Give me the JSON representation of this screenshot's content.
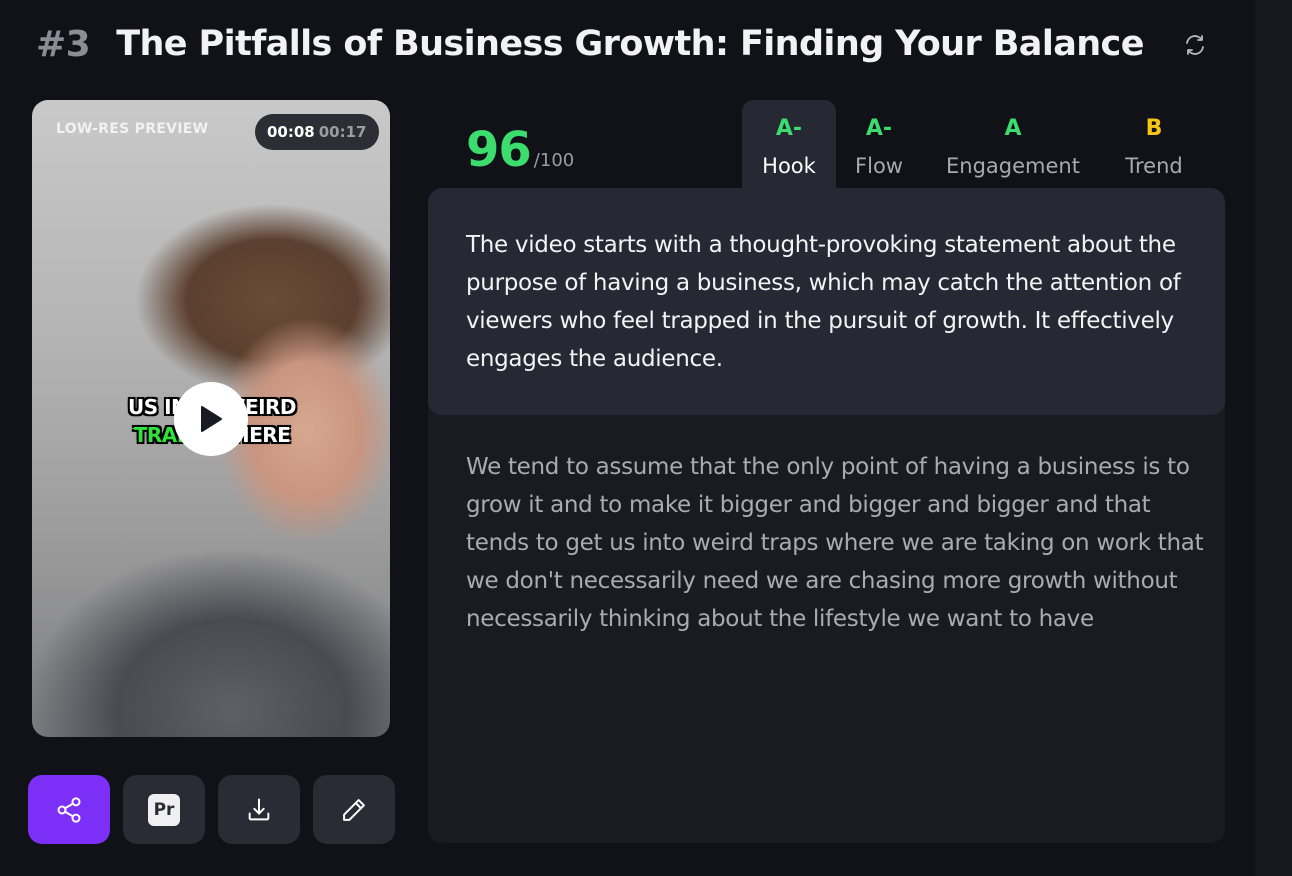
{
  "header": {
    "rank": "#3",
    "title": "The Pitfalls of Business Growth: Finding Your Balance",
    "refresh_icon": "refresh-icon"
  },
  "video": {
    "label": "LOW-RES PREVIEW",
    "time_current": "00:08",
    "time_total": "00:17",
    "caption_line1": "US INTO WEIRD",
    "caption_line2_green": "TRAPS",
    "caption_line2_white": "WHERE",
    "play_icon": "play-icon"
  },
  "actions": {
    "share_icon": "share-icon",
    "premiere_label": "Pr",
    "download_icon": "download-icon",
    "edit_icon": "pencil-icon"
  },
  "score": {
    "value": "96",
    "max": "/100"
  },
  "tabs": [
    {
      "grade": "A-",
      "label": "Hook",
      "active": true,
      "grade_color": "#3ddc6e"
    },
    {
      "grade": "A-",
      "label": "Flow",
      "active": false,
      "grade_color": "#3ddc6e"
    },
    {
      "grade": "A",
      "label": "Engagement",
      "active": false,
      "grade_color": "#3ddc6e"
    },
    {
      "grade": "B",
      "label": "Trend",
      "active": false,
      "grade_color": "#f5c518"
    }
  ],
  "summary": "The video starts with a thought-provoking statement about the purpose of having a business, which may catch the attention of viewers who feel trapped in the pursuit of growth. It effectively engages the audience.",
  "transcript": "We tend to assume that the only point of having a business is to grow it and to make it bigger and bigger and bigger and that tends to get us into weird traps where we are taking on work that we don't necessarily need we are chasing more growth without necessarily thinking about the lifestyle we want to have",
  "colors": {
    "accent": "#7b2ff7",
    "score_green": "#3ddc6e",
    "grade_yellow": "#f5c518",
    "background": "#111217"
  }
}
